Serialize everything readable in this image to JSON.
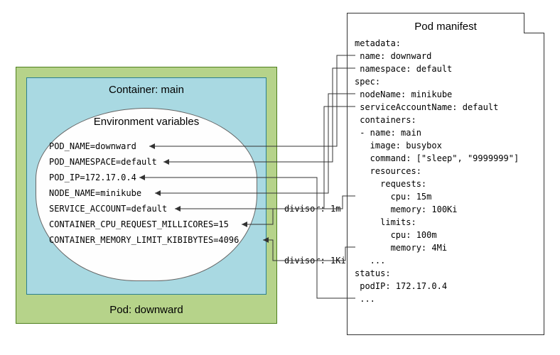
{
  "pod_box_label": "Pod: downward",
  "container_box_label": "Container: main",
  "cloud_title": "Environment variables",
  "env": [
    {
      "k": "POD_NAME",
      "v": "downward"
    },
    {
      "k": "POD_NAMESPACE",
      "v": "default"
    },
    {
      "k": "POD_IP",
      "v": "172.17.0.4"
    },
    {
      "k": "NODE_NAME",
      "v": "minikube"
    },
    {
      "k": "SERVICE_ACCOUNT",
      "v": "default"
    },
    {
      "k": "CONTAINER_CPU_REQUEST_MILLICORES",
      "v": "15"
    },
    {
      "k": "CONTAINER_MEMORY_LIMIT_KIBIBYTES",
      "v": "4096"
    }
  ],
  "divisor_cpu_label": "divisor: 1m",
  "divisor_mem_label": "divisor: 1Ki",
  "manifest_title": "Pod manifest",
  "yaml": {
    "metadata_key": "metadata:",
    "name_line": " name: downward",
    "namespace_line": " namespace: default",
    "spec_key": "spec:",
    "nodeName_line": " nodeName: minikube",
    "svcAcct_line": " serviceAccountName: default",
    "containers_key": " containers:",
    "cname_line": " - name: main",
    "image_line": "   image: busybox",
    "command_line": "   command: [\"sleep\", \"9999999\"]",
    "resources_key": "   resources:",
    "requests_key": "     requests:",
    "req_cpu_line": "       cpu: 15m",
    "req_mem_line": "       memory: 100Ki",
    "limits_key": "     limits:",
    "lim_cpu_line": "       cpu: 100m",
    "lim_mem_line": "       memory: 4Mi",
    "dots1": "   ...",
    "status_key": "status:",
    "podip_line": " podIP: 172.17.0.4",
    "dots2": " ..."
  }
}
